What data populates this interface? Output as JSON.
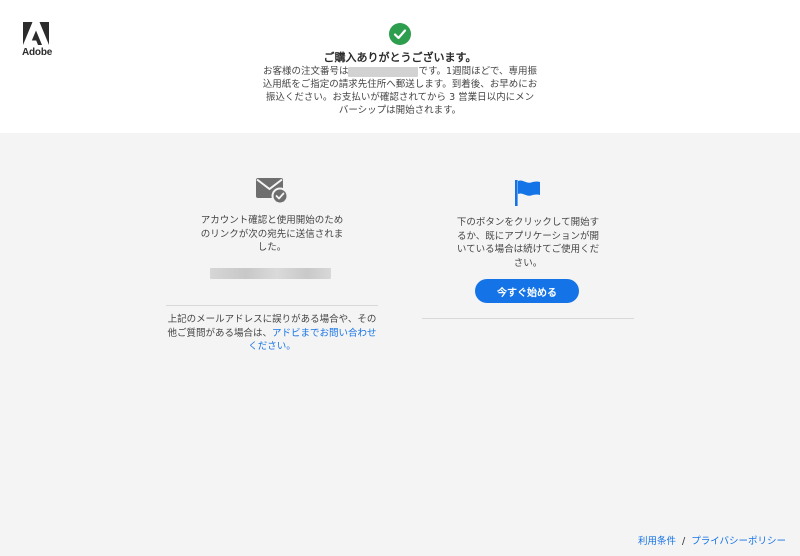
{
  "brand": {
    "logo_icon": "adobe-logo-icon",
    "name": "Adobe",
    "color": "#2c2c2c"
  },
  "header": {
    "status_icon": "checkmark-circle-icon",
    "status_color": "#2d9d4e",
    "title": "ご購入ありがとうございます。",
    "message_lines": [
      {
        "before": "お客様の注文番号は",
        "after": "です。1週間ほどで、専用振"
      },
      {
        "text": "込用紙をご指定の請求先住所へ郵送します。到着後、お早めにお"
      },
      {
        "text": "振込ください。お支払いが確認されてから 3 営業日以内にメン"
      },
      {
        "text": "バーシップは開始されます。"
      }
    ]
  },
  "email_section": {
    "icon": "envelope-check-icon",
    "message_lines": [
      "アカウント確認と使用開始のため",
      "のリンクが次の宛先に送信されま",
      "した。"
    ]
  },
  "note": {
    "lines": [
      "上記のメールアドレスに誤りがある場合や、その",
      "他ご質問がある場合は、"
    ],
    "link_text_1": "アドビまでお問い合わせ",
    "link_text_2": "ください。"
  },
  "start_section": {
    "icon": "flag-icon",
    "message_lines": [
      "下のボタンをクリックして開始す",
      "るか、既にアプリケーションが開",
      "いている場合は続けてご使用くだ",
      "さい。"
    ],
    "button_label": "今すぐ始める",
    "accent": "#1473e6"
  },
  "footer": {
    "terms_label": "利用条件",
    "separator": "/",
    "privacy_label": "プライバシーポリシー"
  }
}
